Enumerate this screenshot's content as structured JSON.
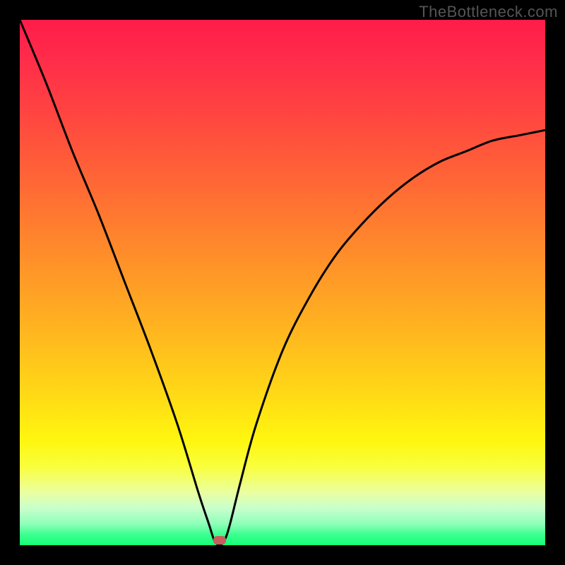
{
  "watermark": "TheBottleneck.com",
  "chart_data": {
    "type": "line",
    "title": "",
    "xlabel": "",
    "ylabel": "",
    "ylim": [
      0,
      100
    ],
    "xlim": [
      0,
      100
    ],
    "background_gradient": {
      "top_color": "#ff1c49",
      "bottom_color": "#15ff78",
      "description": "vertical red→orange→yellow→green gradient"
    },
    "series": [
      {
        "name": "bottleneck-curve",
        "x": [
          0,
          5,
          10,
          15,
          20,
          25,
          30,
          34,
          36,
          37,
          38,
          39,
          40,
          42,
          45,
          50,
          55,
          60,
          65,
          70,
          75,
          80,
          85,
          90,
          95,
          100
        ],
        "values": [
          100,
          88,
          75,
          63,
          50,
          37,
          23,
          10,
          4,
          1,
          0,
          1,
          4,
          12,
          23,
          37,
          47,
          55,
          61,
          66,
          70,
          73,
          75,
          77,
          78,
          79
        ]
      }
    ],
    "marker": {
      "x": 38,
      "y": 1,
      "color": "#c75d5d"
    }
  }
}
